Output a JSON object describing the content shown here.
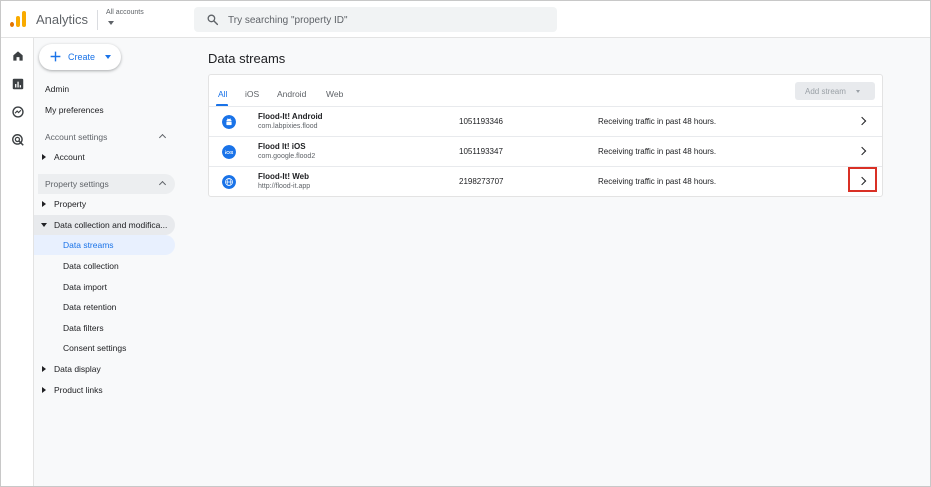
{
  "app": {
    "title": "Analytics",
    "account_selector": "All accounts"
  },
  "search": {
    "placeholder": "Try searching \"property ID\""
  },
  "rail": {
    "items": [
      "home-icon",
      "reports-icon",
      "explore-icon",
      "advertising-icon"
    ]
  },
  "sidebar": {
    "create_label": "Create",
    "admin": "Admin",
    "my_preferences": "My preferences",
    "account_settings": "Account settings",
    "account": "Account",
    "property_settings": "Property settings",
    "property": "Property",
    "data_collection": "Data collection and modifica...",
    "sub_items": [
      "Data streams",
      "Data collection",
      "Data import",
      "Data retention",
      "Data filters",
      "Consent settings"
    ],
    "data_display": "Data display",
    "product_links": "Product links"
  },
  "main": {
    "title": "Data streams",
    "tabs": [
      "All",
      "iOS",
      "Android",
      "Web"
    ],
    "active_tab": "All",
    "add_stream": "Add stream",
    "streams": [
      {
        "name": "Flood-It! Android",
        "sub": "com.labpixies.flood",
        "id": "1051193346",
        "status": "Receiving traffic in past 48 hours.",
        "icon": "android-icon"
      },
      {
        "name": "Flood It! iOS",
        "sub": "com.google.flood2",
        "id": "1051193347",
        "status": "Receiving traffic in past 48 hours.",
        "icon": "ios-icon"
      },
      {
        "name": "Flood-It! Web",
        "sub": "http://flood-it.app",
        "id": "2198273707",
        "status": "Receiving traffic in past 48 hours.",
        "icon": "web-globe-icon"
      }
    ]
  },
  "colors": {
    "accent": "#1a73e8",
    "highlight": "#d93025",
    "logo_dark": "#e37400",
    "logo_light": "#f9ab00"
  }
}
